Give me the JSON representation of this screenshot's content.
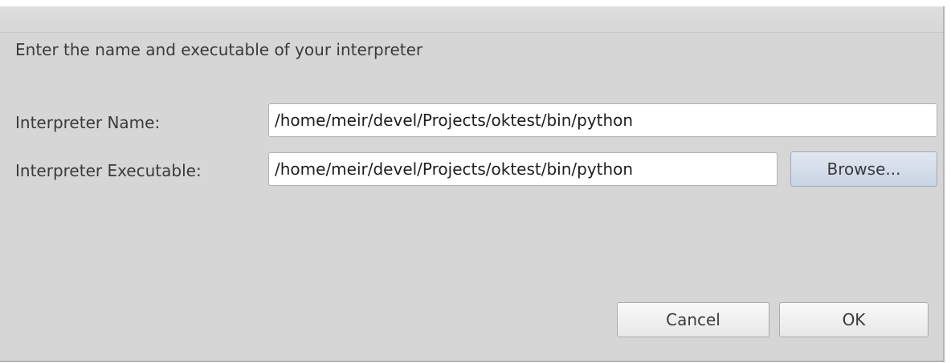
{
  "dialog": {
    "instruction": "Enter the name and executable of your interpreter",
    "name_label": "Interpreter Name:",
    "name_value": "/home/meir/devel/Projects/oktest/bin/python",
    "executable_label": "Interpreter Executable:",
    "executable_value": "/home/meir/devel/Projects/oktest/bin/python",
    "browse_label": "Browse...",
    "cancel_label": "Cancel",
    "ok_label": "OK"
  }
}
